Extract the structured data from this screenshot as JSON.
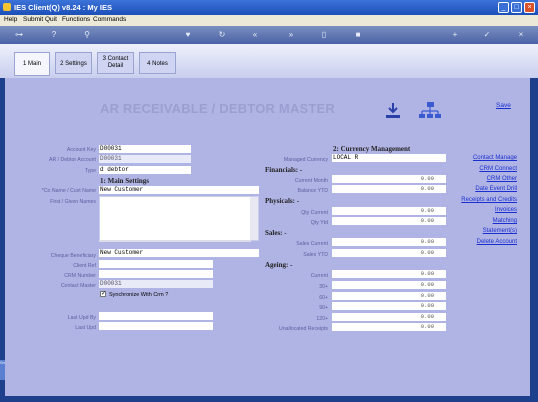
{
  "window": {
    "title": "IES Client(Q) v8.24 : My IES"
  },
  "menu": [
    "Help",
    "Submit",
    "Quit",
    "Functions",
    "Commands"
  ],
  "tabs": [
    {
      "label": "1 Main"
    },
    {
      "label": "2 Settings"
    },
    {
      "label": "3 Contact Detail"
    },
    {
      "label": "4 Notes"
    }
  ],
  "page": {
    "title": "AR RECEIVABLE / DEBTOR MASTER",
    "save_label": "Save"
  },
  "left": {
    "account_key": {
      "label": "Account Key",
      "value": "D00031"
    },
    "debtor_account": {
      "label": "AR / Debtor Account",
      "value": "D00031"
    },
    "type": {
      "label": "Type",
      "value": "d debtor"
    },
    "section1": "1: Main Settings",
    "co_name": {
      "label": "*Co Name / Cust Name",
      "value": "New Customer"
    },
    "first_names": {
      "label": "First / Given Names",
      "value": ""
    },
    "cheque_beneficiary": {
      "label": "Cheque Beneficiary",
      "value": "New Customer"
    },
    "client_ref": {
      "label": "Client Ref",
      "value": ""
    },
    "crm_number": {
      "label": "CRM Number",
      "value": ""
    },
    "contact_master": {
      "label": "Contact Master",
      "value": "D00031"
    },
    "sync_crm": {
      "label": "Synchronize With Crm ?",
      "checked": true
    },
    "last_upd_by": {
      "label": "Last Upd By",
      "value": ""
    },
    "last_upd": {
      "label": "Last Upd",
      "value": ""
    }
  },
  "middle": {
    "section2": "2: Currency Management",
    "managed_currency": {
      "label": "Managed Currency",
      "value": "LOCAL R"
    },
    "financials": "Financials: -",
    "current_month": {
      "label": "Current Month",
      "value": "0.00"
    },
    "balance_ytd": {
      "label": "Balance YTD",
      "value": "0.00"
    },
    "physicals": "Physicals: -",
    "qty_current": {
      "label": "Qty Current",
      "value": "0.00"
    },
    "qty_ytd": {
      "label": "Qty Ytd",
      "value": "0.00"
    },
    "sales": "Sales: -",
    "sales_current": {
      "label": "Sales Current",
      "value": "0.00"
    },
    "sales_ytd": {
      "label": "Sales YTD",
      "value": "0.00"
    },
    "ageing": "Ageing: -",
    "age_current": {
      "label": "Current",
      "value": "0.00"
    },
    "age_30": {
      "label": "30+",
      "value": "0.00"
    },
    "age_60": {
      "label": "60+",
      "value": "0.00"
    },
    "age_90": {
      "label": "90+",
      "value": "0.00"
    },
    "age_120": {
      "label": "120+",
      "value": "0.00"
    },
    "unallocated": {
      "label": "Unallocated Receipts",
      "value": "0.00"
    }
  },
  "links": [
    "Contact Manage",
    "CRM Connect",
    "CRM Other",
    "Date Event Drill",
    "Receipts and Credits",
    "Invoices",
    "Matching",
    "Statement(s)",
    "Delete Account"
  ],
  "sidebar_tab": "Sm"
}
